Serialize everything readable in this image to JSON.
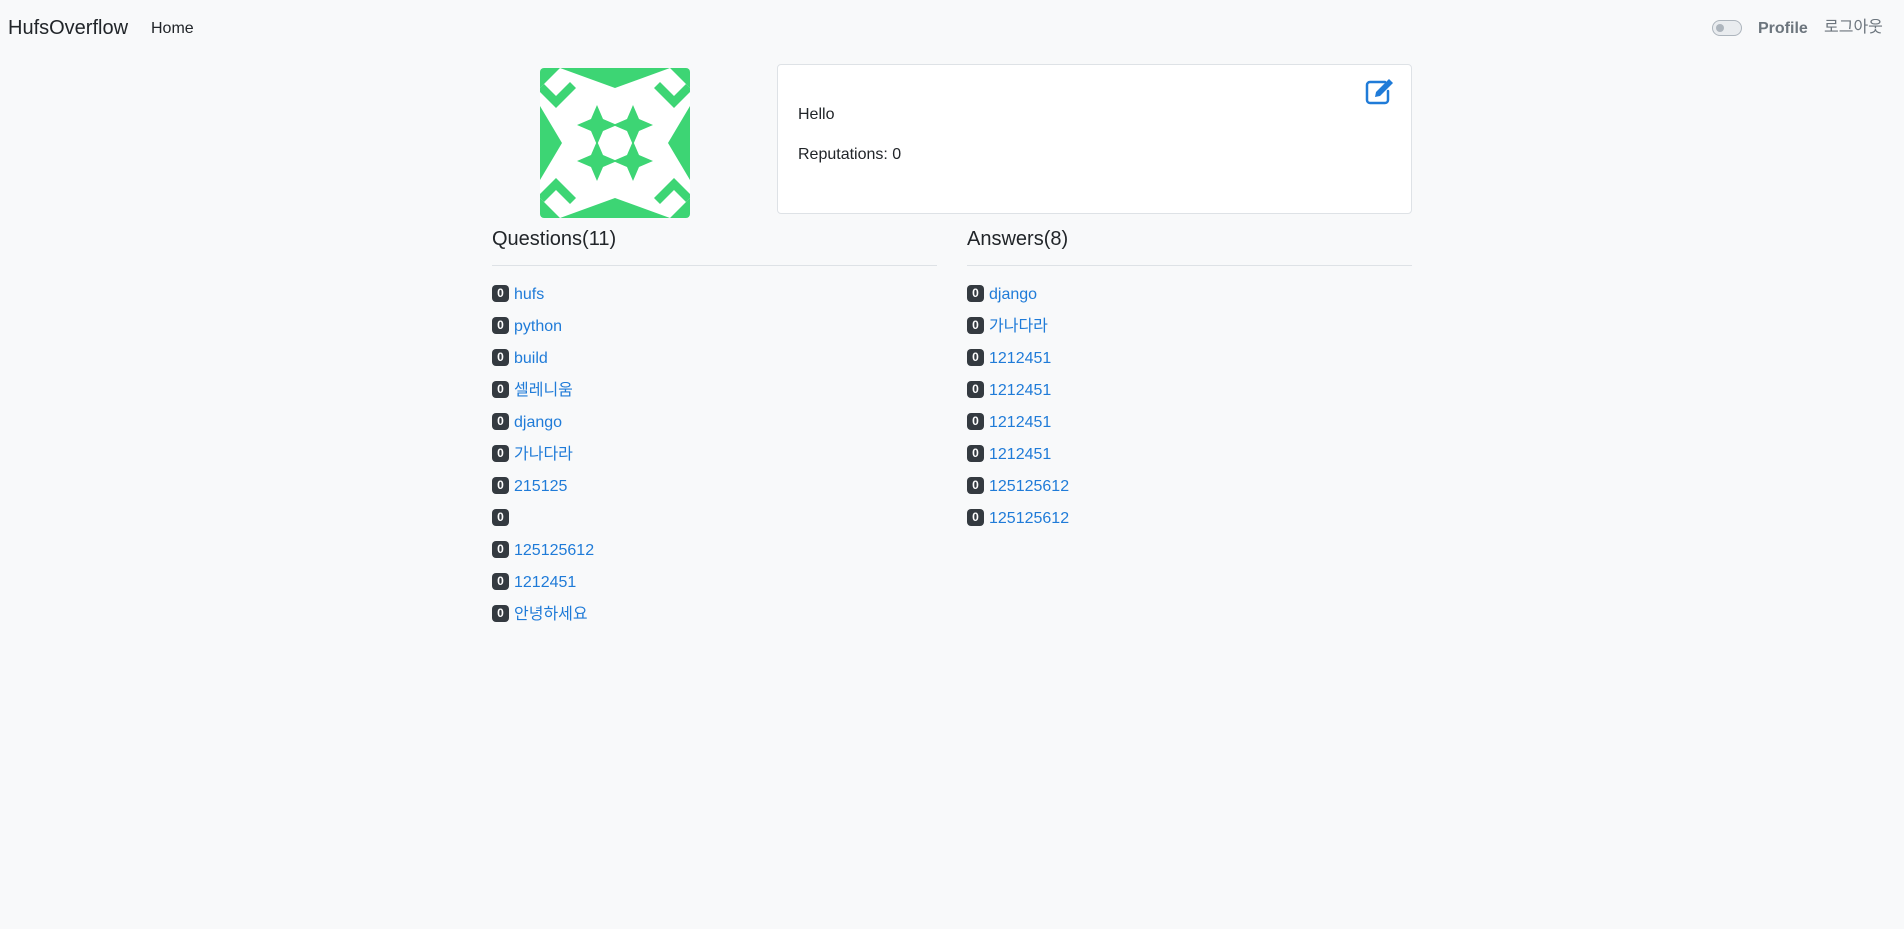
{
  "navbar": {
    "brand": "HufsOverflow",
    "home_label": "Home",
    "profile_label": "Profile",
    "logout_label": "로그아웃",
    "theme_toggle_on": false
  },
  "profile": {
    "avatar_color": "#3dd574",
    "bio": "Hello",
    "reputation_label": "Reputations: 0"
  },
  "questions": {
    "heading": "Questions(11)",
    "items": [
      {
        "score": "0",
        "title": "hufs"
      },
      {
        "score": "0",
        "title": "python"
      },
      {
        "score": "0",
        "title": "build"
      },
      {
        "score": "0",
        "title": "셀레니움"
      },
      {
        "score": "0",
        "title": "django"
      },
      {
        "score": "0",
        "title": "가나다라"
      },
      {
        "score": "0",
        "title": "215125"
      },
      {
        "score": "0",
        "title": ""
      },
      {
        "score": "0",
        "title": "125125612"
      },
      {
        "score": "0",
        "title": "1212451"
      },
      {
        "score": "0",
        "title": "안녕하세요"
      }
    ]
  },
  "answers": {
    "heading": "Answers(8)",
    "items": [
      {
        "score": "0",
        "title": "django"
      },
      {
        "score": "0",
        "title": "가나다라"
      },
      {
        "score": "0",
        "title": "1212451"
      },
      {
        "score": "0",
        "title": "1212451"
      },
      {
        "score": "0",
        "title": "1212451"
      },
      {
        "score": "0",
        "title": "1212451"
      },
      {
        "score": "0",
        "title": "125125612"
      },
      {
        "score": "0",
        "title": "125125612"
      }
    ]
  },
  "colors": {
    "link": "#1f7bd8",
    "badge_bg": "#343a40",
    "background": "#f8f9fa"
  },
  "icons": {
    "edit": "edit-icon"
  }
}
